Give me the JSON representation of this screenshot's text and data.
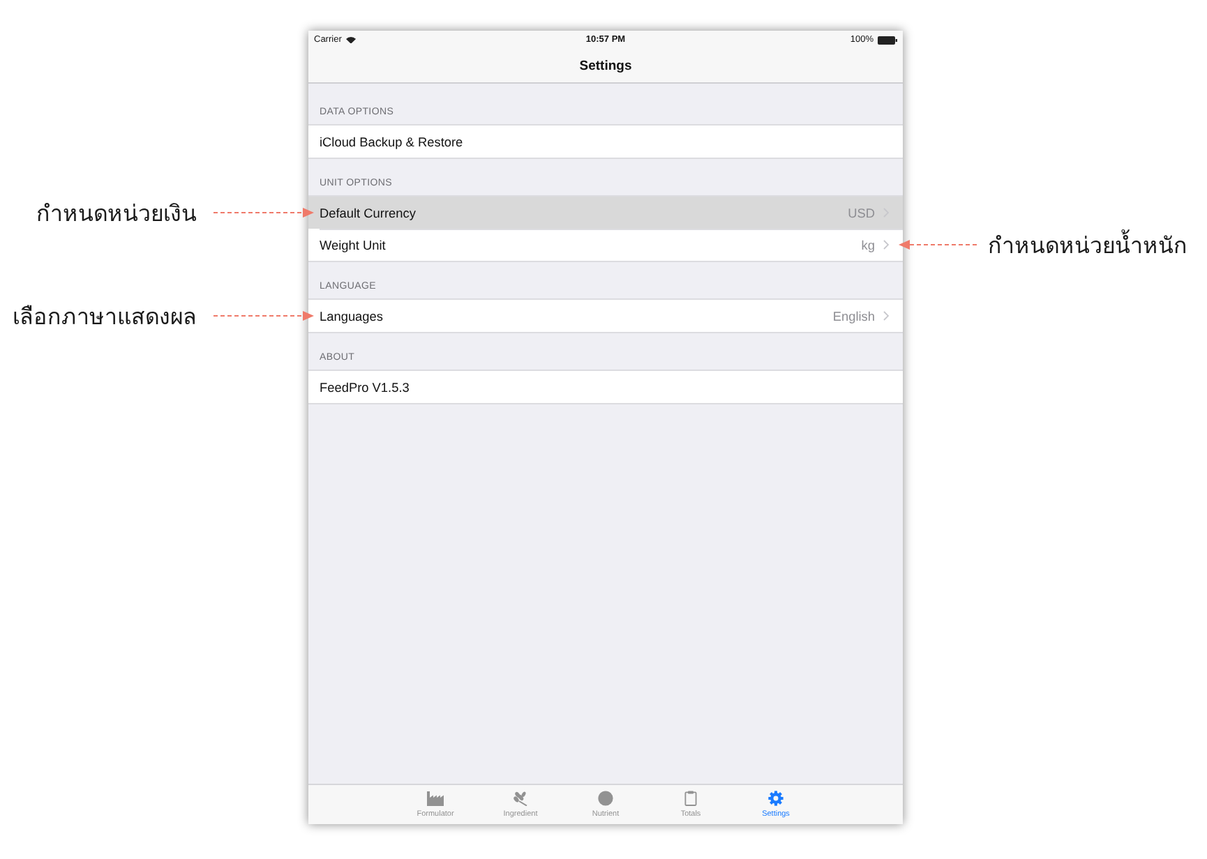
{
  "status_bar": {
    "carrier": "Carrier",
    "time": "10:57 PM",
    "battery": "100%"
  },
  "nav_bar": {
    "title": "Settings"
  },
  "sections": [
    {
      "header": "DATA OPTIONS",
      "rows": [
        {
          "label": "iCloud Backup & Restore",
          "selected": false,
          "disclosure": false
        }
      ]
    },
    {
      "header": "UNIT OPTIONS",
      "rows": [
        {
          "label": "Default Currency",
          "value": "USD",
          "selected": true,
          "disclosure": true,
          "callout": {
            "text": "กำหนดหน่วยเงิน",
            "kind": "left"
          }
        },
        {
          "label": "Weight Unit",
          "value": "kg",
          "selected": false,
          "disclosure": true,
          "callout": {
            "text": "กำหนดหน่วยน้ำหนัก",
            "kind": "right"
          }
        }
      ]
    },
    {
      "header": "LANGUAGE",
      "rows": [
        {
          "label": "Languages",
          "value": "English",
          "selected": false,
          "disclosure": true,
          "callout": {
            "text": "เลือกภาษาแสดงผล",
            "kind": "left"
          }
        }
      ]
    },
    {
      "header": "ABOUT",
      "rows": [
        {
          "label": "FeedPro V1.5.3",
          "selected": false,
          "disclosure": false
        }
      ]
    }
  ],
  "tab_bar": {
    "items": [
      {
        "label": "Formulator",
        "selected": false
      },
      {
        "label": "Ingredient",
        "selected": false
      },
      {
        "label": "Nutrient",
        "selected": false
      },
      {
        "label": "Totals",
        "selected": false
      },
      {
        "label": "Settings",
        "selected": true
      }
    ]
  }
}
